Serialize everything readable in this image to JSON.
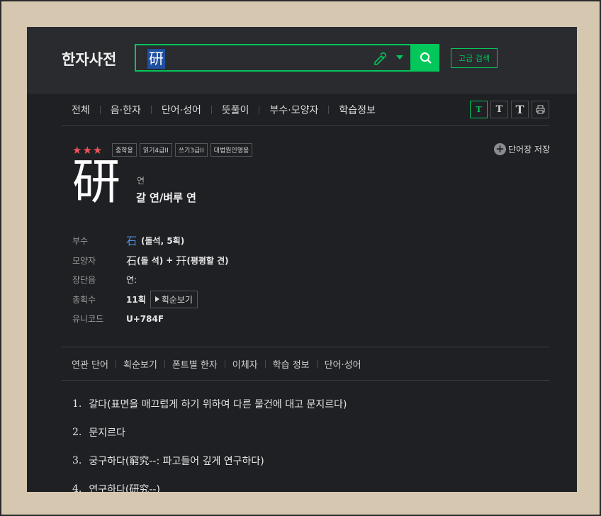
{
  "header": {
    "logo": "한자사전",
    "search_value": "研",
    "advanced_label": "고급 검색"
  },
  "tabs": [
    {
      "label": "전체"
    },
    {
      "label": "음·한자"
    },
    {
      "label": "단어·성어"
    },
    {
      "label": "뜻풀이"
    },
    {
      "label": "부수·모양자"
    },
    {
      "label": "학습정보"
    }
  ],
  "font_buttons": {
    "small": "T",
    "medium": "T",
    "large": "T",
    "print_icon": "print-icon"
  },
  "entry": {
    "stars": "★★★",
    "badges": [
      "중학용",
      "읽기4급II",
      "쓰기3급II",
      "대법원인명용"
    ],
    "save_label": "단어장 저장",
    "hanja": "研",
    "reading": "연",
    "meaning": "갈 연/벼루 연",
    "info": {
      "radical_label": "부수",
      "radical_char": "石",
      "radical_detail": "(돌석, 5획)",
      "shape_label": "모양자",
      "shape_char1": "石",
      "shape_detail1": "(돌 석)",
      "shape_plus": "+",
      "shape_char2": "幵",
      "shape_detail2": "(평평할 견)",
      "length_label": "장단음",
      "length_value": "연:",
      "strokes_label": "총획수",
      "strokes_value": "11획",
      "stroke_order_label": "획순보기",
      "unicode_label": "유니코드",
      "unicode_value": "U+784F"
    }
  },
  "subtabs": [
    {
      "label": "연관 단어"
    },
    {
      "label": "획순보기"
    },
    {
      "label": "폰트별 한자"
    },
    {
      "label": "이체자"
    },
    {
      "label": "학습 정보"
    },
    {
      "label": "단어·성어"
    }
  ],
  "definitions": [
    {
      "num": "1.",
      "text": "갈다(표면을 매끄럽게 하기 위하여 다른 물건에 대고 문지르다)"
    },
    {
      "num": "2.",
      "text": "문지르다"
    },
    {
      "num": "3.",
      "text": "궁구하다(窮究--: 파고들어 깊게 연구하다)"
    },
    {
      "num": "4.",
      "text": "연구하다(研究--)"
    }
  ],
  "colors": {
    "accent": "#03c75a",
    "star": "#f0525a",
    "link": "#4d8fe0",
    "background": "#1f2023"
  }
}
